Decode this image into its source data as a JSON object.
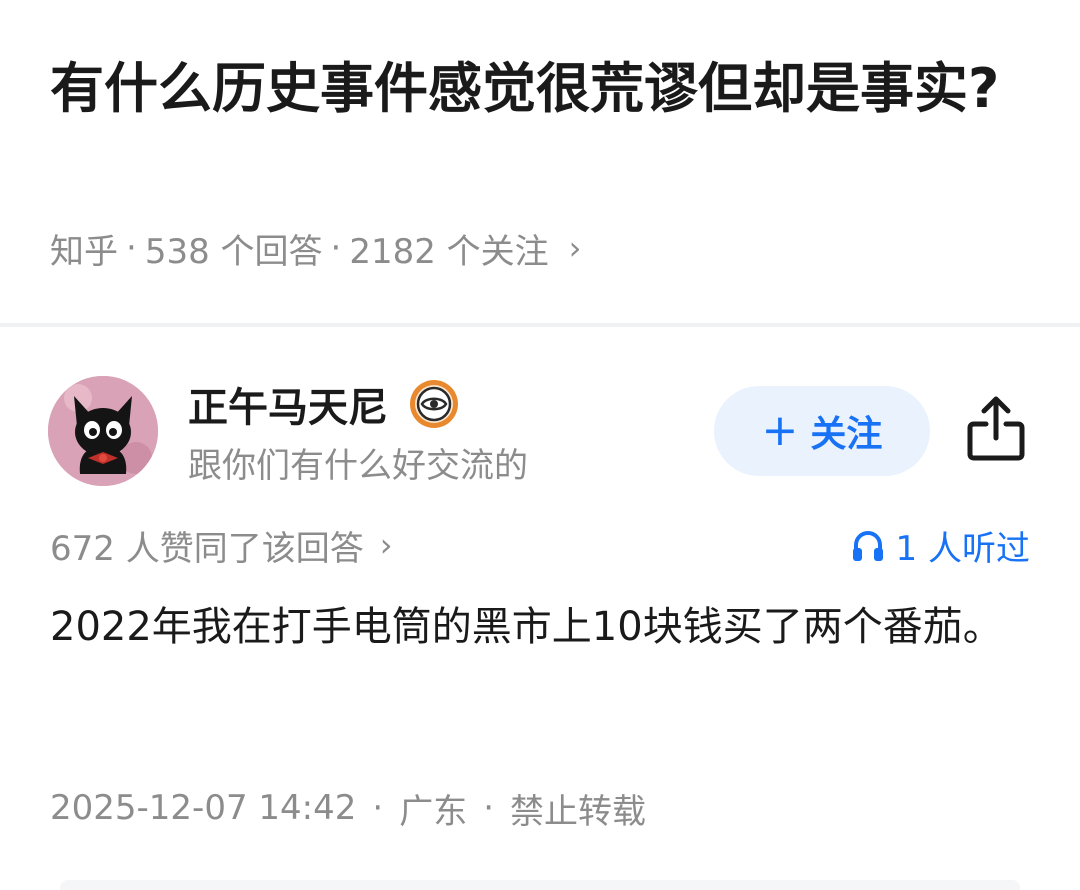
{
  "question": {
    "title": "有什么历史事件感觉很荒谬但却是事实?",
    "source": "知乎",
    "separator": "·",
    "answers_count": "538 个回答",
    "followers_count": "2182 个关注",
    "chevron": "›"
  },
  "author": {
    "name": "正午马天尼",
    "bio": "跟你们有什么好交流的",
    "follow_plus": "+",
    "follow_label": "关注",
    "avatar_icon": "black-cat-avatar",
    "badge_icon": "eye-badge-icon",
    "share_icon": "share-icon"
  },
  "stats": {
    "votes": "672 人赞同了该回答",
    "chevron": "›",
    "listens": "1 人听过",
    "listen_icon": "headphones-icon"
  },
  "answer": {
    "content": "2022年我在打手电筒的黑市上10块钱买了两个番茄。"
  },
  "footer": {
    "datetime": "2025-12-07 14:42",
    "separator": "·",
    "location": "广东",
    "copyright": "禁止转载"
  },
  "colors": {
    "accent": "#1772f6",
    "follow_bg": "#eaf2fe",
    "muted_text": "#8c8c8c",
    "primary_text": "#1a1a1a",
    "divider": "#f0f1f3",
    "badge_orange": "#e8892f"
  }
}
